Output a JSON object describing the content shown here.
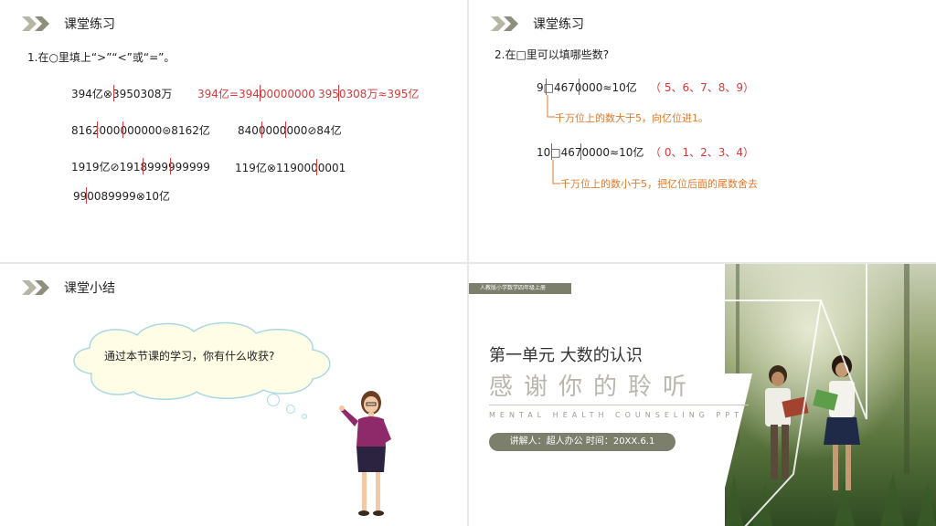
{
  "panel1": {
    "header": "课堂练习",
    "instruction": "1.在○里填上“>”“<”或“=”。",
    "rows": [
      {
        "left": "394亿⊗3950308万",
        "mid": "394亿=39400000000",
        "right": "3950308万≈395亿"
      },
      {
        "left": "8162000000000⊜8162亿",
        "right": "8400000000⊘84亿"
      },
      {
        "left": "1919亿⊘1918999999999",
        "right": "119亿⊗1190000001"
      },
      {
        "left": "990089999⊗10亿"
      }
    ]
  },
  "panel2": {
    "header": "课堂练习",
    "question": "2.在□里可以填哪些数?",
    "q1": "9□4670000≈10亿",
    "a1": "（ 5、6、7、8、9）",
    "note1": "千万位上的数大于5，向亿位进1。",
    "q2": "10□4670000≈10亿",
    "a2": "（ 0、1、2、3、4）",
    "note2": "千万位上的数小于5，把亿位后面的尾数舍去"
  },
  "panel3": {
    "header": "课堂小结",
    "cloud_text": "通过本节课的学习，你有什么收获?"
  },
  "panel4": {
    "caption": "人教版小学数学四年级上册",
    "title": "第一单元   大数的认识",
    "thanks": "感谢你的聆听",
    "subtitle_en": "MENTAL HEALTH COUNSELING PPT",
    "presenter": "讲解人：超人办公  时间：20XX.6.1"
  },
  "colors": {
    "accent_red": "#d63a3a",
    "accent_orange": "#e07a2c",
    "olive": "#7c7f6c",
    "chevron": "#b5b6a4"
  }
}
